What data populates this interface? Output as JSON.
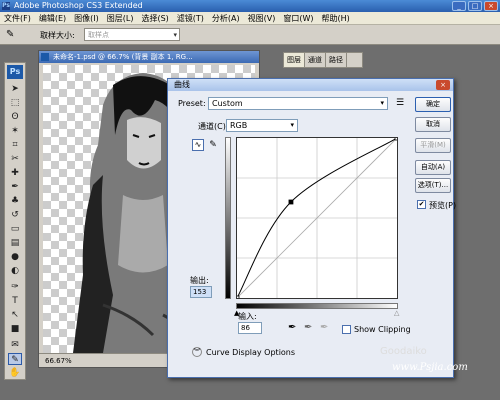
{
  "app": {
    "title": "Adobe Photoshop CS3 Extended",
    "logo": "Ps"
  },
  "menu": [
    "文件(F)",
    "编辑(E)",
    "图像(I)",
    "图层(L)",
    "选择(S)",
    "滤镜(T)",
    "分析(A)",
    "视图(V)",
    "窗口(W)",
    "帮助(H)"
  ],
  "options": {
    "sample_label": "取样大小:",
    "sample_value": "取样点"
  },
  "document": {
    "title": "未命名-1.psd @ 66.7% (背景 副本 1, RG...",
    "zoom": "66.67%"
  },
  "layers_panel": {
    "tabs": [
      "图层",
      "通道",
      "路径"
    ]
  },
  "curves": {
    "title": "曲线",
    "preset_label": "Preset:",
    "preset_value": "Custom",
    "channel_label": "通道(C):",
    "channel_value": "RGB",
    "output_label": "输出:",
    "output_value": "153",
    "input_label": "输入:",
    "input_value": "86",
    "show_clipping": "Show Clipping",
    "display_options": "Curve Display Options",
    "buttons": {
      "ok": "确定",
      "cancel": "取消",
      "smooth": "平滑(M)",
      "auto": "自动(A)",
      "options": "选项(T)...",
      "preview": "预览(P)"
    },
    "curve_points": [
      [
        0,
        0
      ],
      [
        86,
        153
      ],
      [
        255,
        255
      ]
    ]
  },
  "watermark": {
    "brand": "Goodaiko",
    "url": "www.Psjia.com"
  }
}
